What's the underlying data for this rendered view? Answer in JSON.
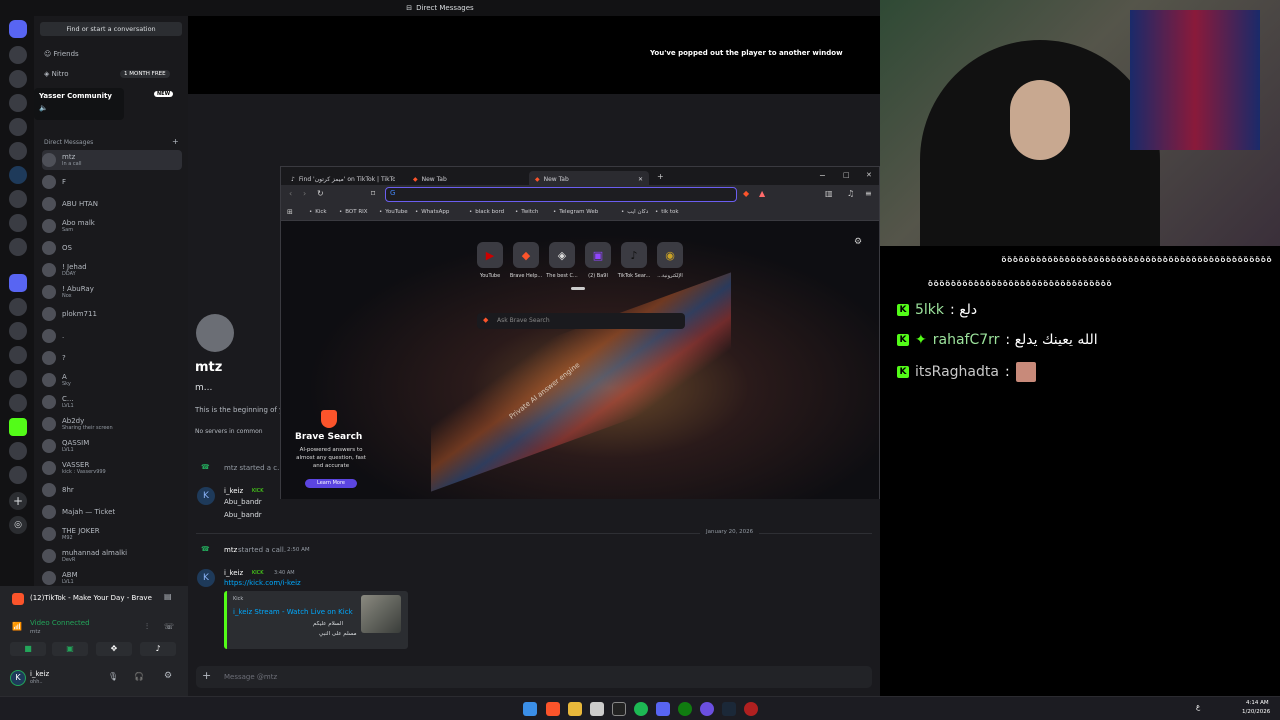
{
  "window": {
    "title": "Direct Messages"
  },
  "sidebar": {
    "find_placeholder": "Find or start a conversation",
    "friends": "Friends",
    "nitro": "Nitro",
    "nitro_badge": "1 MONTH FREE",
    "community": "Yasser Community",
    "community_badge": "NEW",
    "dm_header": "Direct Messages",
    "dms": [
      {
        "name": "mtz",
        "sub": "In a call"
      },
      {
        "name": "F",
        "sub": ""
      },
      {
        "name": "ABU HTAN",
        "sub": ""
      },
      {
        "name": "Abo malk",
        "sub": "Sam"
      },
      {
        "name": "OS",
        "sub": ""
      },
      {
        "name": "! Jehad",
        "sub": "DDAY"
      },
      {
        "name": "! AbuRay",
        "sub": "Nox"
      },
      {
        "name": "plokm711",
        "sub": ""
      },
      {
        "name": ".",
        "sub": ""
      },
      {
        "name": "?",
        "sub": ""
      },
      {
        "name": "A",
        "sub": "Sky"
      },
      {
        "name": "C...",
        "sub": "LVL1"
      },
      {
        "name": "Ab2dy",
        "sub": "Sharing their screen"
      },
      {
        "name": "QASSIM",
        "sub": "LVL1"
      },
      {
        "name": "VASSER",
        "sub": "kick : Vasserv999"
      },
      {
        "name": "8hr",
        "sub": ""
      },
      {
        "name": "Majah — Ticket",
        "sub": ""
      },
      {
        "name": "THE JOKER",
        "sub": "M92"
      },
      {
        "name": "muhannad almalki",
        "sub": "DevR"
      },
      {
        "name": "ABM",
        "sub": "LVL1"
      }
    ]
  },
  "voice": {
    "activity": "(12)TikTok - Make Your Day - Brave",
    "status": "Video Connected",
    "channel": "mtz",
    "user": "i_keiz",
    "user_sub": "ohh.."
  },
  "chat": {
    "popout_text": "You've popped out the player to another window",
    "profile_name": "mtz",
    "profile_sub": "m...",
    "beginning": "This is the beginning of y",
    "no_servers": "No servers in common",
    "call1": "mtz started a c...",
    "msg1_author": "i_keiz",
    "msg1_badge": "KICK",
    "msg1_line1": "Abu_bandr",
    "msg1_line2": "Abu_bandr",
    "date_divider": "January 20, 2026",
    "call2_name": "mtz",
    "call2_text": "started a call.",
    "call2_time": "2:50 AM",
    "msg2_author": "i_keiz",
    "msg2_badge": "KICK",
    "msg2_time": "3:40 AM",
    "msg2_link": "https://kick.com/i-keiz",
    "embed_site": "Kick",
    "embed_title": "i_keiz Stream - Watch Live on Kick",
    "embed_desc1": "السلام عليكم",
    "embed_desc2": "مسلم على النبي",
    "input_placeholder": "Message @mtz"
  },
  "browser": {
    "tabs": [
      "Find 'ميمز كرتون' on TikTok | TikTok Se...",
      "New Tab",
      "New Tab"
    ],
    "bookmarks": [
      "Kick",
      "BOT RIX",
      "YouTube",
      "WhatsApp",
      "black bord",
      "Twitch",
      "Telegram Web",
      "دكان ايب",
      "tik tok"
    ],
    "tiles": [
      "YouTube",
      "Brave Help...",
      "The best C...",
      "(2) Ba9l",
      "TikTok Sear...",
      "...الإلكترونية"
    ],
    "search_placeholder": "Ask Brave Search",
    "promo_title": "Brave Search",
    "promo_desc": "AI-powered answers to almost any question, fast and accurate",
    "promo_button": "Learn More",
    "hero_text": "Private AI answer engine"
  },
  "stream_chat": {
    "spam1": "ةةةةةةةةةةةةةةةةةةةةةةةةةةةةةةةةةةةةةةةةةةةةةةة",
    "spam2": "ةةةةةةةةةةةةةةةةةةةةةةةةةةةةةةةة",
    "lines": [
      {
        "user": "5lkk",
        "text": ": دلع"
      },
      {
        "user": "rahafC7rr",
        "text": ": الله يعينك يدلع"
      },
      {
        "user": "itsRaghadta",
        "text": ":"
      }
    ],
    "kick_color": "#53fc18"
  },
  "taskbar": {
    "time": "4:14 AM",
    "date": "1/20/2026",
    "lang": "ع"
  }
}
